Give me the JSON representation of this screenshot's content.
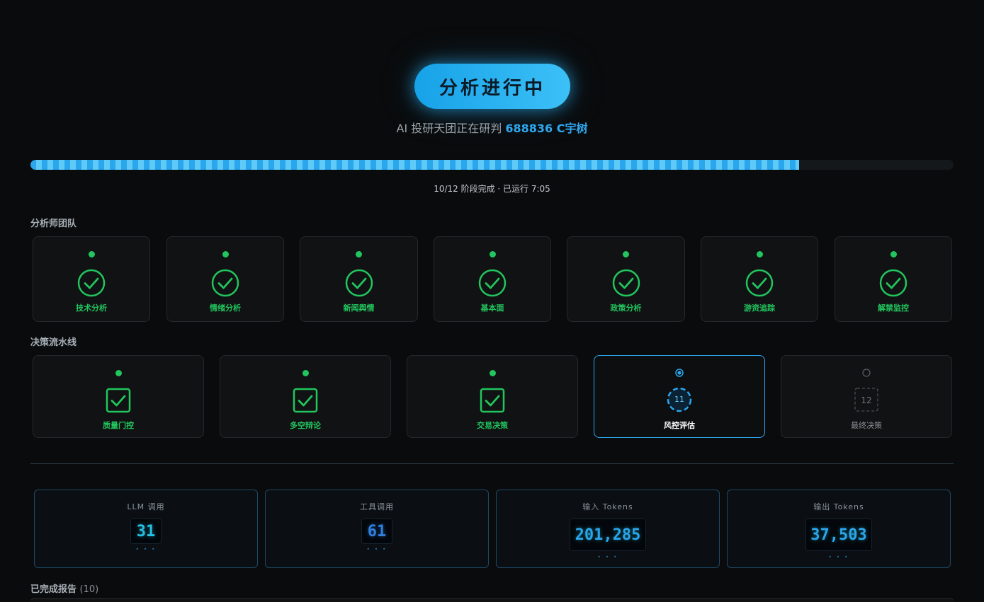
{
  "header": {
    "status": "分析进行中",
    "subtitle_prefix": "AI 投研天团正在研判",
    "stock": "688836 C宇树"
  },
  "progress": {
    "fraction": 0.833,
    "text": "10/12 阶段完成 · 已运行 7:05"
  },
  "analysts": {
    "title": "分析师团队",
    "items": [
      {
        "label": "技术分析",
        "icon": "check-circle-icon",
        "status": "done"
      },
      {
        "label": "情绪分析",
        "icon": "check-circle-icon",
        "status": "done"
      },
      {
        "label": "新闻舆情",
        "icon": "check-circle-icon",
        "status": "done"
      },
      {
        "label": "基本面",
        "icon": "check-circle-icon",
        "status": "done"
      },
      {
        "label": "政策分析",
        "icon": "check-circle-icon",
        "status": "done"
      },
      {
        "label": "游资追踪",
        "icon": "check-circle-icon",
        "status": "done"
      },
      {
        "label": "解禁监控",
        "icon": "check-circle-icon",
        "status": "done"
      }
    ]
  },
  "pipeline": {
    "title": "决策流水线",
    "items": [
      {
        "label": "质量门控",
        "status": "done"
      },
      {
        "label": "多空辩论",
        "status": "done"
      },
      {
        "label": "交易决策",
        "status": "done"
      },
      {
        "label": "风控评估",
        "status": "active",
        "num": "11"
      },
      {
        "label": "最终决策",
        "status": "pending",
        "num": "12"
      }
    ]
  },
  "metrics": [
    {
      "label": "LLM 调用",
      "value": "31",
      "dots": "• • •"
    },
    {
      "label": "工具调用",
      "value": "61",
      "dots": "• • •"
    },
    {
      "label": "输入 Tokens",
      "value": "201,285",
      "dots": "• • •"
    },
    {
      "label": "输出 Tokens",
      "value": "37,503",
      "dots": "• • •"
    }
  ],
  "reports": {
    "title": "已完成报告",
    "count": "(10)"
  },
  "colors": {
    "accent": "#2aa6ec",
    "success": "#22c55e",
    "background": "#0a0b0c"
  }
}
